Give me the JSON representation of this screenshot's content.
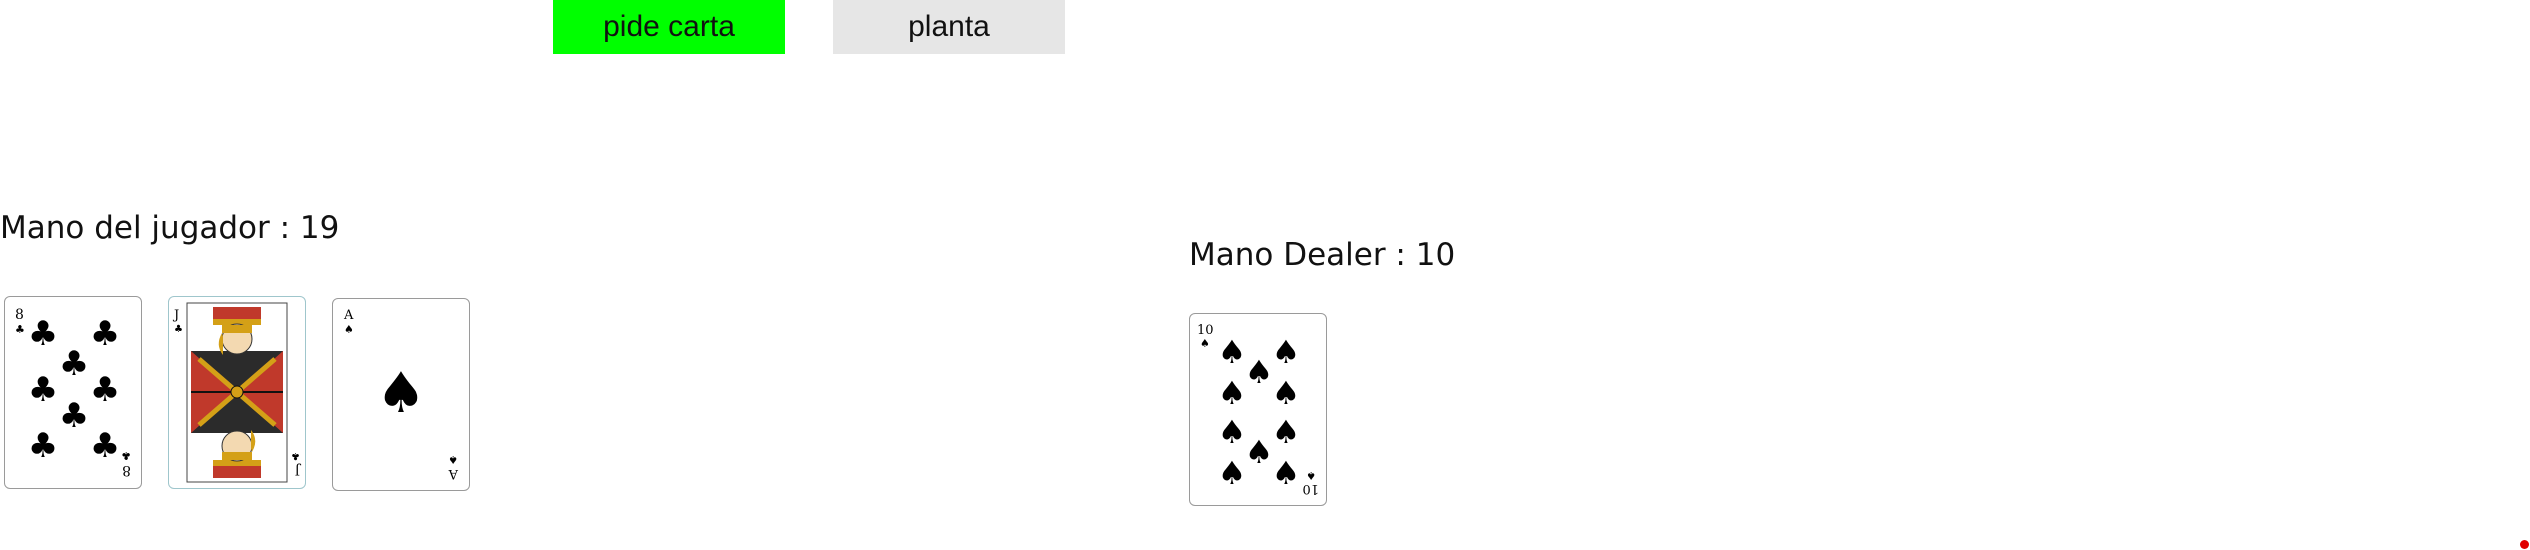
{
  "colors": {
    "hit_button_bg": "#00ff00",
    "stand_button_bg": "#e6e6e6",
    "indicator_dot": "#e00000",
    "face_card_red": "#c0392b",
    "face_card_gold": "#d4a017"
  },
  "controls": {
    "hit_label": "pide carta",
    "stand_label": "planta"
  },
  "player": {
    "label": "Mano del jugador : 19",
    "cards": [
      {
        "rank": "8",
        "suit": "clubs",
        "suit_icon": "club-icon"
      },
      {
        "rank": "J",
        "suit": "clubs",
        "suit_icon": "club-icon"
      },
      {
        "rank": "A",
        "suit": "spades",
        "suit_icon": "spade-icon"
      }
    ]
  },
  "dealer": {
    "label": "Mano Dealer : 10",
    "cards": [
      {
        "rank": "10",
        "suit": "spades",
        "suit_icon": "spade-icon"
      }
    ]
  }
}
